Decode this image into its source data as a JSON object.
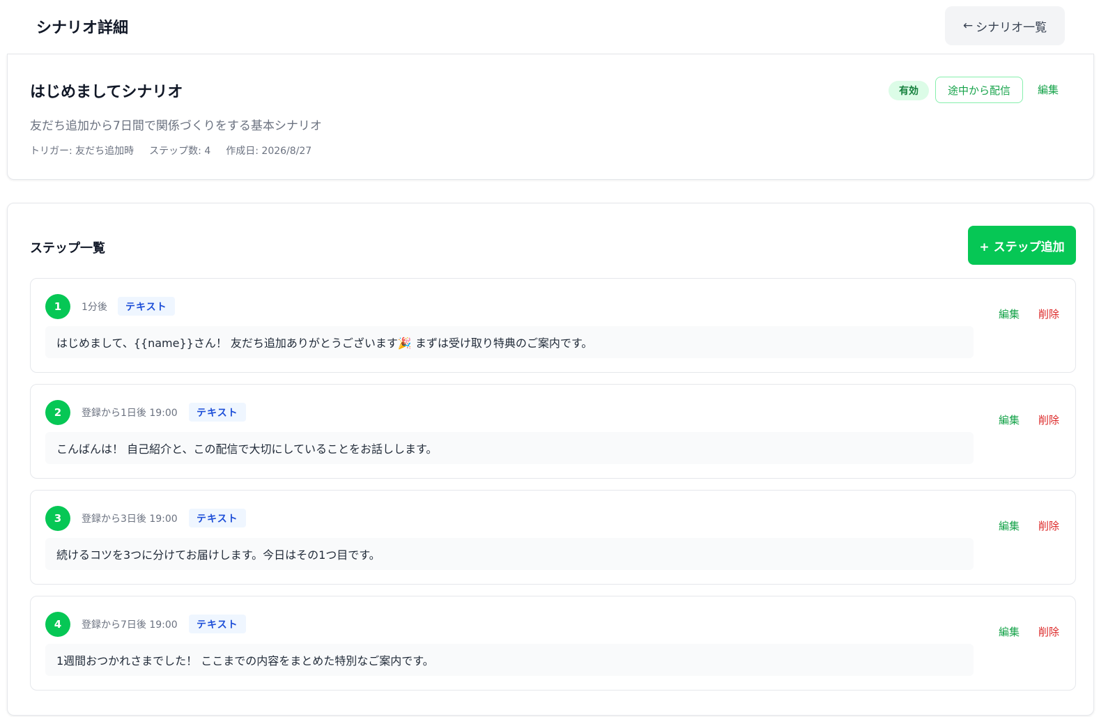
{
  "header": {
    "title": "シナリオ詳細",
    "back_arrow": "←",
    "back_label": "シナリオ一覧"
  },
  "scenario": {
    "name": "はじめましてシナリオ",
    "description": "友だち追加から7日間で関係づくりをする基本シナリオ",
    "trigger": "トリガー: 友だち追加時",
    "step_count": "ステップ数: 4",
    "created": "作成日: 2026/8/27",
    "status_badge": "有効",
    "resend_label": "途中から配信",
    "edit_label": "編集"
  },
  "steps_section": {
    "title": "ステップ一覧",
    "add_label": "+ ステップ追加"
  },
  "steps": [
    {
      "number": "1",
      "timing": "1分後",
      "type": "テキスト",
      "message": "はじめまして、{{name}}さん！ 友だち追加ありがとうございます🎉 まずは受け取り特典のご案内です。",
      "edit_label": "編集",
      "delete_label": "削除"
    },
    {
      "number": "2",
      "timing": "登録から1日後 19:00",
      "type": "テキスト",
      "message": "こんばんは！ 自己紹介と、この配信で大切にしていることをお話しします。",
      "edit_label": "編集",
      "delete_label": "削除"
    },
    {
      "number": "3",
      "timing": "登録から3日後 19:00",
      "type": "テキスト",
      "message": "続けるコツを3つに分けてお届けします。今日はその1つ目です。",
      "edit_label": "編集",
      "delete_label": "削除"
    },
    {
      "number": "4",
      "timing": "登録から7日後 19:00",
      "type": "テキスト",
      "message": "1週間おつかれさまでした！ ここまでの内容をまとめた特別なご案内です。",
      "edit_label": "編集",
      "delete_label": "削除"
    }
  ],
  "colors": {
    "brand_green": "#06c755",
    "badge_bg": "#dcfce7",
    "type_badge_bg": "#eff6ff",
    "delete_red": "#dc2626"
  }
}
